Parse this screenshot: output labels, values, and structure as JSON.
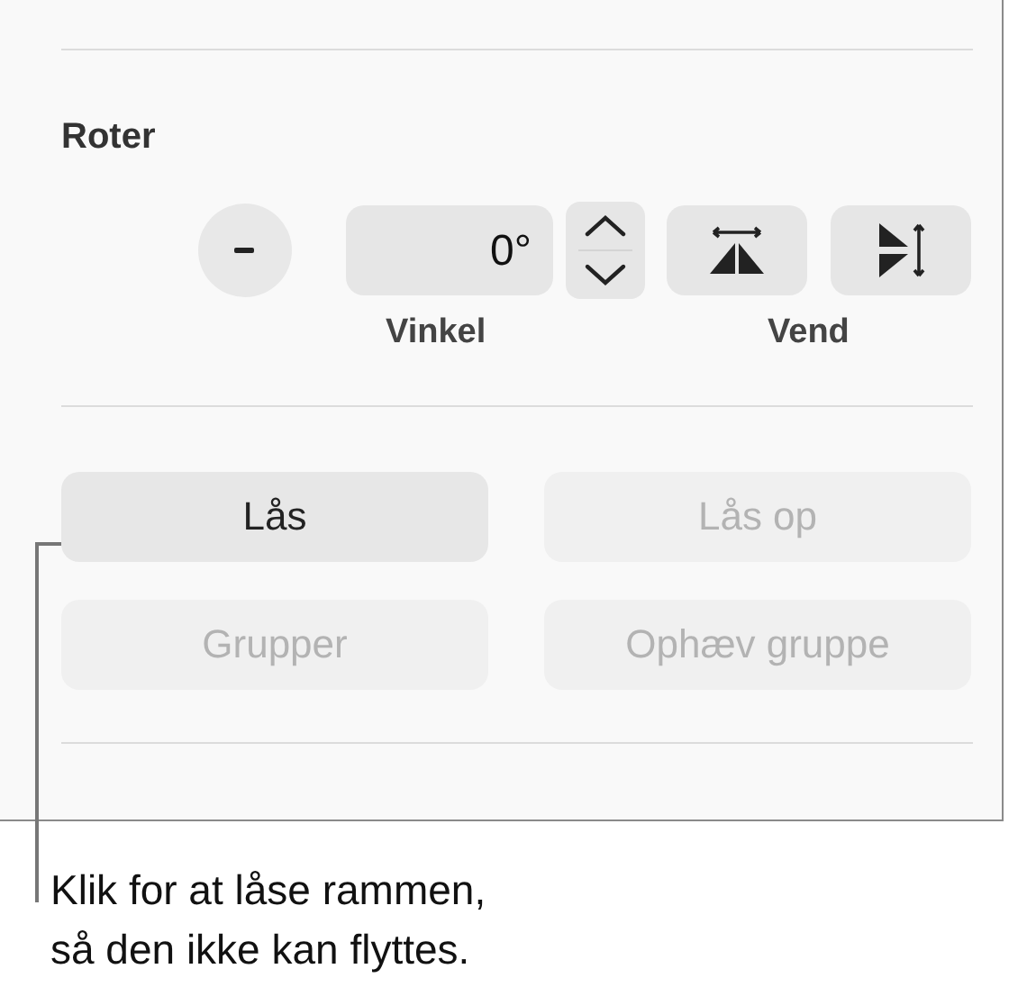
{
  "section": {
    "title": "Roter"
  },
  "angle": {
    "value": "0°",
    "label": "Vinkel"
  },
  "flip": {
    "label": "Vend"
  },
  "buttons": [
    {
      "label": "Lås",
      "disabled": false
    },
    {
      "label": "Lås op",
      "disabled": true
    },
    {
      "label": "Grupper",
      "disabled": true
    },
    {
      "label": "Ophæv gruppe",
      "disabled": true
    }
  ],
  "callout": {
    "text": "Klik for at låse rammen,\nså den ikke kan flyttes."
  }
}
